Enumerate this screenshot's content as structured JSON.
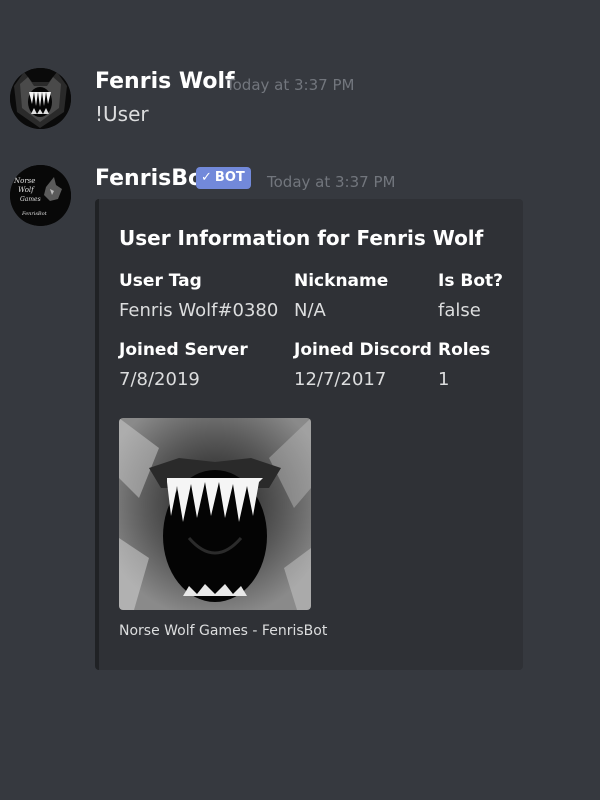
{
  "messages": [
    {
      "username": "Fenris Wolf",
      "timestamp": "Today at 3:37 PM",
      "content": "!User",
      "avatar_icon": "wolf-icon"
    },
    {
      "username": "FenrisBot",
      "bot_tag": "BOT",
      "timestamp": "Today at 3:37 PM",
      "avatar_text": [
        "Norse",
        "Wolf",
        "Games",
        "FenrisBot"
      ],
      "embed": {
        "title": "User Information for Fenris Wolf",
        "fields": [
          {
            "name": "User Tag",
            "value": "Fenris Wolf#0380"
          },
          {
            "name": "Nickname",
            "value": "N/A"
          },
          {
            "name": "Is Bot?",
            "value": "false"
          },
          {
            "name": "Joined Server",
            "value": "7/8/2019"
          },
          {
            "name": "Joined Discord",
            "value": "12/7/2017"
          },
          {
            "name": "Roles",
            "value": "1"
          }
        ],
        "image_icon": "wolf-jaws-image",
        "footer": "Norse Wolf Games - FenrisBot"
      }
    }
  ],
  "colors": {
    "background": "#36393f",
    "embed_background": "#2f3136",
    "bot_tag": "#7289da",
    "timestamp": "#72767d"
  }
}
